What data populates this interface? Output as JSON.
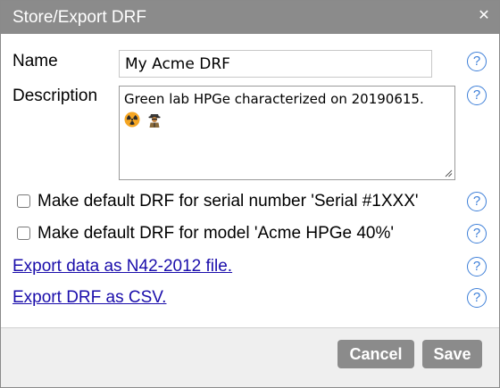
{
  "dialog": {
    "title": "Store/Export DRF",
    "close_glyph": "✕"
  },
  "form": {
    "name_label": "Name",
    "name_value": "My Acme DRF",
    "description_label": "Description",
    "description_value": "Green lab HPGe characterized on 20190615.",
    "description_emoji": [
      "radioactive-emoji",
      "detective-emoji"
    ],
    "default_serial_label": "Make default DRF for serial number 'Serial #1XXX'",
    "default_model_label": "Make default DRF for model 'Acme HPGe 40%'",
    "export_n42_link": "Export data as N42-2012 file.",
    "export_csv_link": "Export DRF as CSV.",
    "help_glyph": "?"
  },
  "footer": {
    "cancel_label": "Cancel",
    "save_label": "Save"
  },
  "colors": {
    "titlebar": "#8b8b8b",
    "link": "#1a0dab",
    "help": "#3d7fd8",
    "button": "#8b8b8b"
  }
}
